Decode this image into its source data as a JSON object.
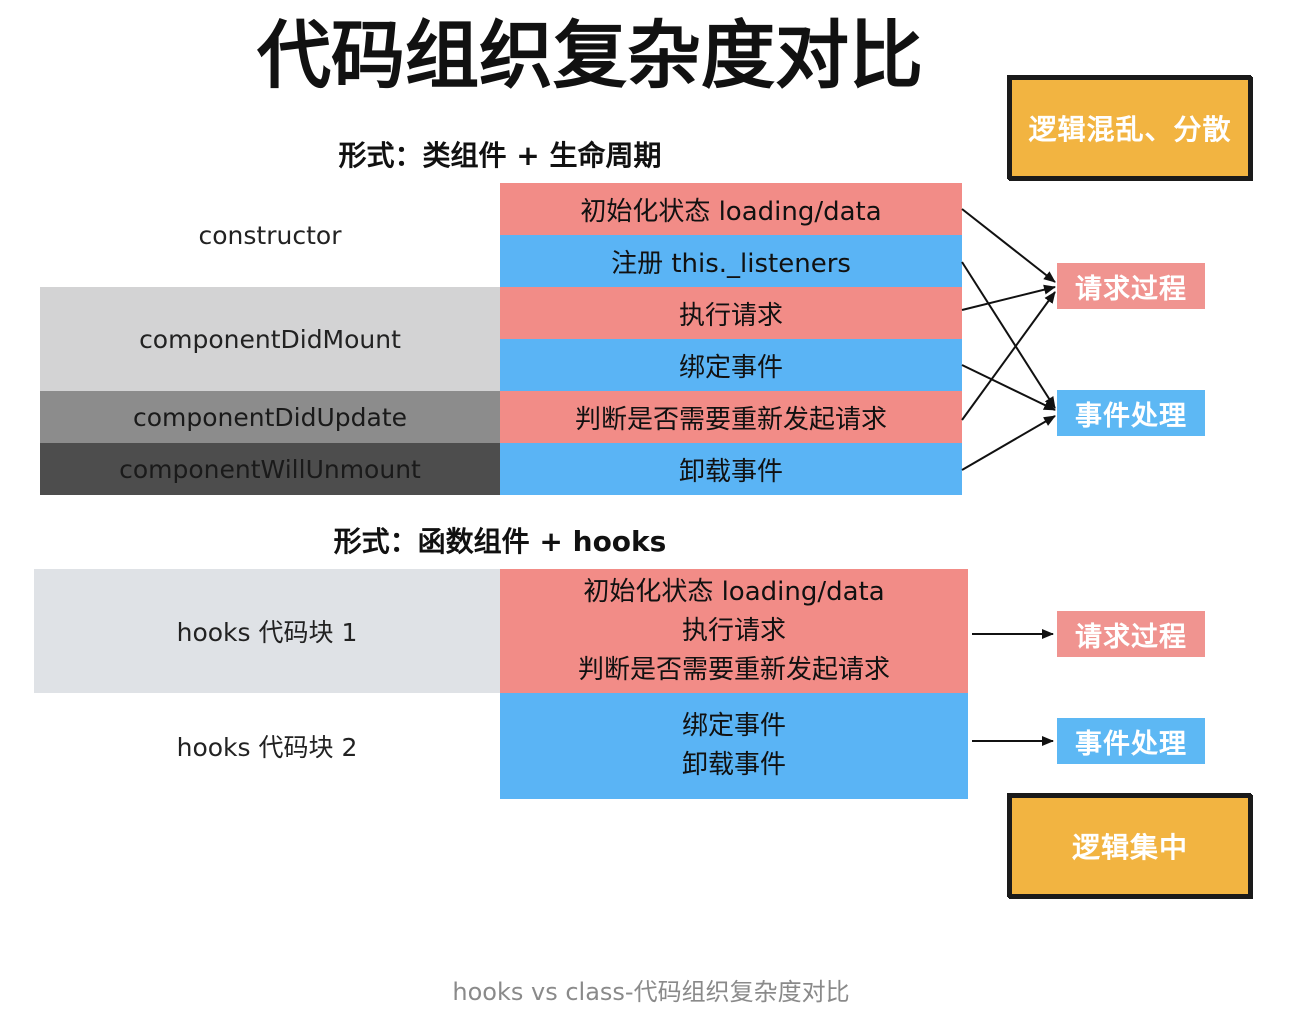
{
  "title": "代码组织复杂度对比",
  "class_section": {
    "heading": "形式：类组件 + 生命周期",
    "lifecycle": {
      "constructor": "constructor",
      "did_mount": "componentDidMount",
      "did_update": "componentDidUpdate",
      "will_unmount": "componentWillUnmount"
    },
    "steps": [
      "初始化状态 loading/data",
      "注册 this._listeners",
      "执行请求",
      "绑定事件",
      "判断是否需要重新发起请求",
      "卸载事件"
    ],
    "tags": {
      "request": "请求过程",
      "event": "事件处理"
    },
    "callout": "逻辑混乱、分散"
  },
  "hooks_section": {
    "heading": "形式：函数组件 + hooks",
    "block1": {
      "label": "hooks 代码块 1",
      "lines": [
        "初始化状态 loading/data",
        "执行请求",
        "判断是否需要重新发起请求"
      ]
    },
    "block2": {
      "label": "hooks 代码块 2",
      "lines": [
        "绑定事件",
        "卸载事件"
      ]
    },
    "tags": {
      "request": "请求过程",
      "event": "事件处理"
    },
    "callout": "逻辑集中"
  },
  "caption": "hooks vs class-代码组织复杂度对比",
  "colors": {
    "pink": "#f28c87",
    "blue": "#5ab4f5",
    "callout": "#f2b441",
    "mount_gray": "#d3d3d4",
    "update_gray": "#8c8c8c",
    "unmount_gray": "#4d4d4d",
    "hooks_gray": "#dfe2e6"
  }
}
